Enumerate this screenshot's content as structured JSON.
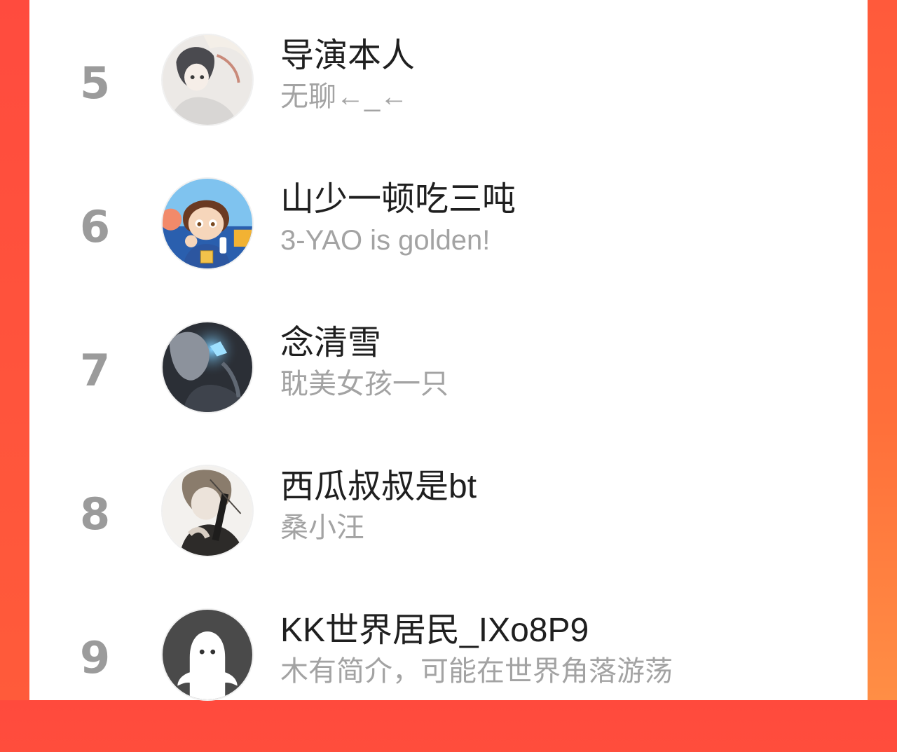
{
  "leaderboard": {
    "rows": [
      {
        "rank": "5",
        "name": "导演本人",
        "bio": "无聊←_←",
        "avatar": "anime-boy-avatar"
      },
      {
        "rank": "6",
        "name": "山少一顿吃三吨",
        "bio": "3-YAO is golden!",
        "avatar": "cartoon-kid-avatar"
      },
      {
        "rank": "7",
        "name": "念清雪",
        "bio": "耽美女孩一只",
        "avatar": "dark-anime-avatar"
      },
      {
        "rank": "8",
        "name": "西瓜叔叔是bt",
        "bio": "桑小汪",
        "avatar": "sketch-boy-avatar"
      },
      {
        "rank": "9",
        "name": "KK世界居民_IXo8P9",
        "bio": "木有简介，可能在世界角落游荡",
        "avatar": "default-ghost-avatar"
      }
    ]
  },
  "colors": {
    "background_accent": "#ff5a3b",
    "name_text": "#1f1f1f",
    "bio_text": "#a3a3a3",
    "rank_text": "#9b9b9b"
  }
}
